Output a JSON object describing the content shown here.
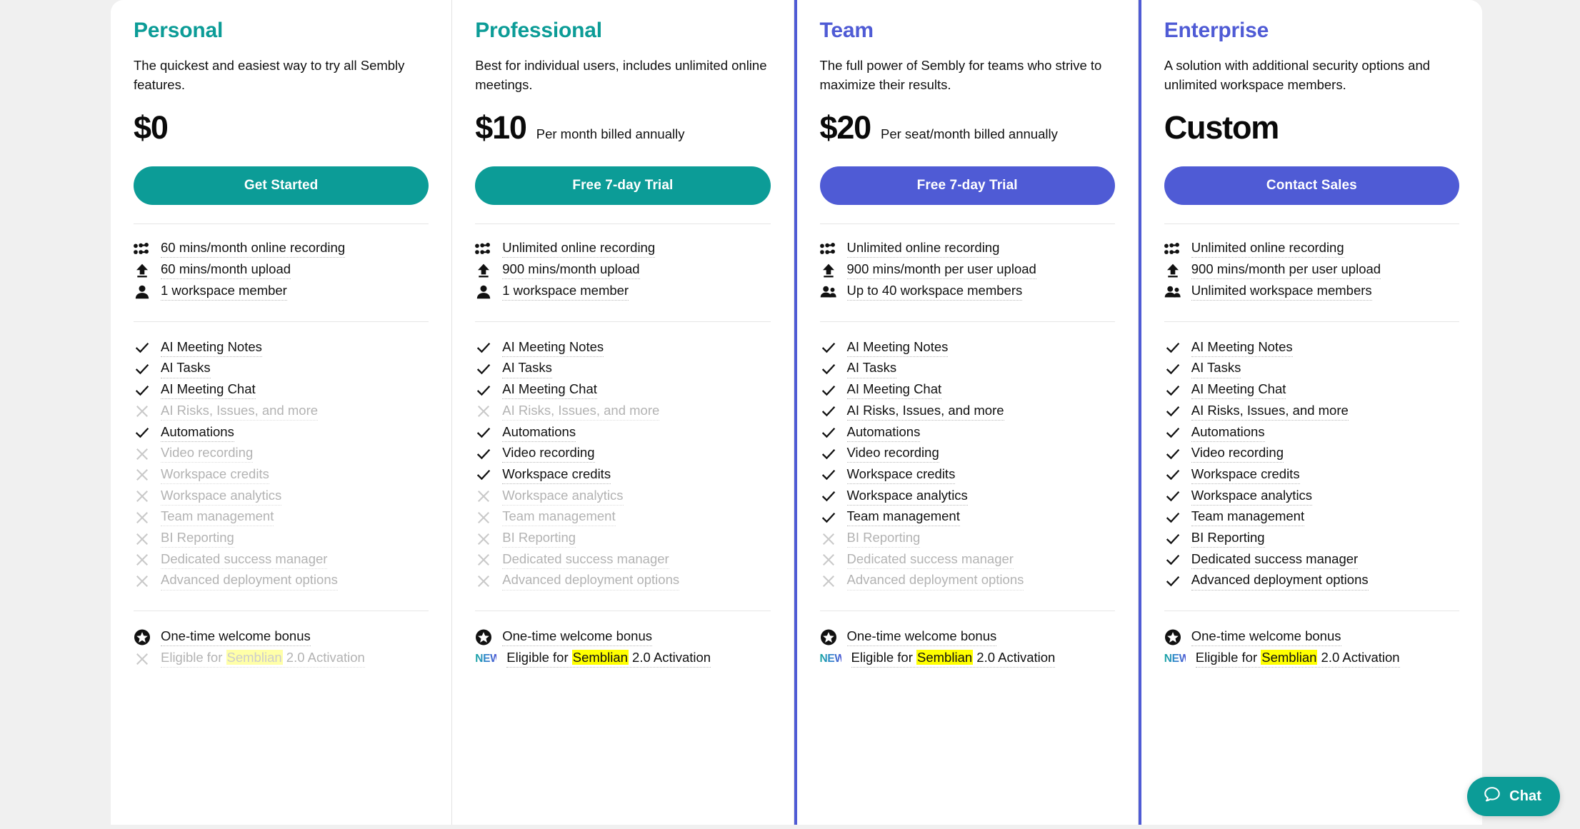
{
  "page": {
    "background": "#f0f0f0",
    "card_background": "#ffffff",
    "teal": "#0c9c97",
    "indigo": "#4f5bd5",
    "highlight": "#ffff00"
  },
  "plans": [
    {
      "name": "Personal",
      "accent": "teal",
      "featured": false,
      "description": "The quickest and easiest way to try all Sembly features.",
      "price": "$0",
      "price_note": "",
      "cta_label": "Get Started",
      "limits": [
        {
          "icon": "recording-icon",
          "label": "60 mins/month online recording"
        },
        {
          "icon": "upload-icon",
          "label": "60 mins/month upload"
        },
        {
          "icon": "person-icon",
          "label": "1 workspace member"
        }
      ],
      "features": [
        {
          "label": "AI Meeting Notes",
          "included": true
        },
        {
          "label": "AI Tasks",
          "included": true
        },
        {
          "label": "AI Meeting Chat",
          "included": true
        },
        {
          "label": "AI Risks, Issues, and more",
          "included": false
        },
        {
          "label": "Automations",
          "included": true
        },
        {
          "label": "Video recording",
          "included": false
        },
        {
          "label": "Workspace credits",
          "included": false
        },
        {
          "label": "Workspace analytics",
          "included": false
        },
        {
          "label": "Team management",
          "included": false
        },
        {
          "label": "BI Reporting",
          "included": false
        },
        {
          "label": "Dedicated success manager",
          "included": false
        },
        {
          "label": "Advanced deployment options",
          "included": false
        }
      ],
      "bonus": [
        {
          "icon": "star-icon",
          "label": "One-time welcome bonus",
          "included": true
        },
        {
          "icon": "x-icon",
          "included": false,
          "prefix": "Eligible for ",
          "highlight": "Semblian",
          "suffix": " 2.0 Activation"
        }
      ]
    },
    {
      "name": "Professional",
      "accent": "teal",
      "featured": false,
      "description": "Best for individual users, includes unlimited online meetings.",
      "price": "$10",
      "price_note": "Per month billed annually",
      "cta_label": "Free 7-day Trial",
      "limits": [
        {
          "icon": "recording-icon",
          "label": "Unlimited online recording"
        },
        {
          "icon": "upload-icon",
          "label": "900 mins/month upload"
        },
        {
          "icon": "person-icon",
          "label": "1 workspace member"
        }
      ],
      "features": [
        {
          "label": "AI Meeting Notes",
          "included": true
        },
        {
          "label": "AI Tasks",
          "included": true
        },
        {
          "label": "AI Meeting Chat",
          "included": true
        },
        {
          "label": "AI Risks, Issues, and more",
          "included": false
        },
        {
          "label": "Automations",
          "included": true
        },
        {
          "label": "Video recording",
          "included": true
        },
        {
          "label": "Workspace credits",
          "included": true
        },
        {
          "label": "Workspace analytics",
          "included": false
        },
        {
          "label": "Team management",
          "included": false
        },
        {
          "label": "BI Reporting",
          "included": false
        },
        {
          "label": "Dedicated success manager",
          "included": false
        },
        {
          "label": "Advanced deployment options",
          "included": false
        }
      ],
      "bonus": [
        {
          "icon": "star-icon",
          "label": "One-time welcome bonus",
          "included": true
        },
        {
          "icon": "new-badge",
          "badge_text": "NEW",
          "included": true,
          "prefix": "Eligible for ",
          "highlight": "Semblian",
          "suffix": " 2.0 Activation"
        }
      ]
    },
    {
      "name": "Team",
      "accent": "indigo",
      "featured": true,
      "description": "The full power of Sembly for teams who strive to maximize their results.",
      "price": "$20",
      "price_note": "Per seat/month billed annually",
      "cta_label": "Free 7-day Trial",
      "limits": [
        {
          "icon": "recording-icon",
          "label": "Unlimited online recording"
        },
        {
          "icon": "upload-icon",
          "label": "900 mins/month per user upload"
        },
        {
          "icon": "group-icon",
          "label": "Up to 40 workspace members"
        }
      ],
      "features": [
        {
          "label": "AI Meeting Notes",
          "included": true
        },
        {
          "label": "AI Tasks",
          "included": true
        },
        {
          "label": "AI Meeting Chat",
          "included": true
        },
        {
          "label": "AI Risks, Issues, and more",
          "included": true
        },
        {
          "label": "Automations",
          "included": true
        },
        {
          "label": "Video recording",
          "included": true
        },
        {
          "label": "Workspace credits",
          "included": true
        },
        {
          "label": "Workspace analytics",
          "included": true
        },
        {
          "label": "Team management",
          "included": true
        },
        {
          "label": "BI Reporting",
          "included": false
        },
        {
          "label": "Dedicated success manager",
          "included": false
        },
        {
          "label": "Advanced deployment options",
          "included": false
        }
      ],
      "bonus": [
        {
          "icon": "star-icon",
          "label": "One-time welcome bonus",
          "included": true
        },
        {
          "icon": "new-badge",
          "badge_text": "NEW",
          "included": true,
          "prefix": "Eligible for ",
          "highlight": "Semblian",
          "suffix": " 2.0 Activation"
        }
      ]
    },
    {
      "name": "Enterprise",
      "accent": "indigo",
      "featured": true,
      "description": "A solution with additional security options and unlimited workspace members.",
      "price": "Custom",
      "price_note": "",
      "cta_label": "Contact Sales",
      "limits": [
        {
          "icon": "recording-icon",
          "label": "Unlimited online recording"
        },
        {
          "icon": "upload-icon",
          "label": "900 mins/month per user upload"
        },
        {
          "icon": "group-icon",
          "label": "Unlimited workspace members"
        }
      ],
      "features": [
        {
          "label": "AI Meeting Notes",
          "included": true
        },
        {
          "label": "AI Tasks",
          "included": true
        },
        {
          "label": "AI Meeting Chat",
          "included": true
        },
        {
          "label": "AI Risks, Issues, and more",
          "included": true
        },
        {
          "label": "Automations",
          "included": true
        },
        {
          "label": "Video recording",
          "included": true
        },
        {
          "label": "Workspace credits",
          "included": true
        },
        {
          "label": "Workspace analytics",
          "included": true
        },
        {
          "label": "Team management",
          "included": true
        },
        {
          "label": "BI Reporting",
          "included": true
        },
        {
          "label": "Dedicated success manager",
          "included": true
        },
        {
          "label": "Advanced deployment options",
          "included": true
        }
      ],
      "bonus": [
        {
          "icon": "star-icon",
          "label": "One-time welcome bonus",
          "included": true
        },
        {
          "icon": "new-badge",
          "badge_text": "NEW",
          "included": true,
          "prefix": "Eligible for ",
          "highlight": "Semblian",
          "suffix": " 2.0 Activation"
        }
      ]
    }
  ],
  "chat_widget": {
    "label": "Chat",
    "icon": "chat-bubble-icon"
  }
}
